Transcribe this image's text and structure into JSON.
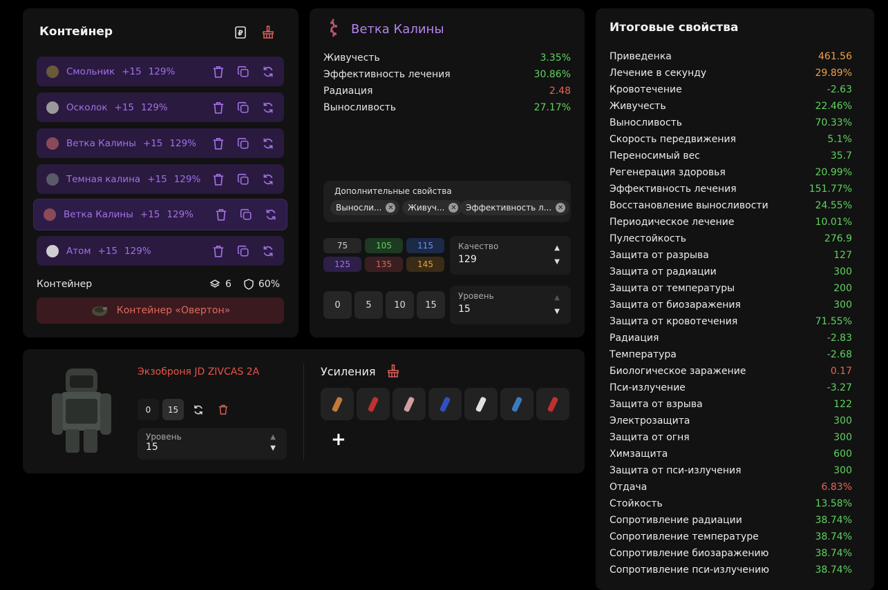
{
  "container": {
    "title": "Контейнер",
    "artifacts": [
      {
        "name": "Смольник",
        "level": "+15",
        "percent": "129%",
        "thumb": "#6b5a3a"
      },
      {
        "name": "Осколок",
        "level": "+15",
        "percent": "129%",
        "thumb": "#9a9a9a"
      },
      {
        "name": "Ветка Калины",
        "level": "+15",
        "percent": "129%",
        "thumb": "#8a4a5a"
      },
      {
        "name": "Темная калина",
        "level": "+15",
        "percent": "129%",
        "thumb": "#5a5a6a"
      },
      {
        "name": "Ветка Калины",
        "level": "+15",
        "percent": "129%",
        "thumb": "#8a4a5a"
      },
      {
        "name": "Атом",
        "level": "+15",
        "percent": "129%",
        "thumb": "#cfcfcf"
      }
    ],
    "summary_label": "Контейнер",
    "slots": "6",
    "protection": "60%",
    "button_label": "Контейнер «Овертон»"
  },
  "artifact": {
    "name": "Ветка Калины",
    "stats": [
      {
        "name": "Живучесть",
        "value": "3.35%",
        "color": "green"
      },
      {
        "name": "Эффективность лечения",
        "value": "30.86%",
        "color": "green"
      },
      {
        "name": "Радиация",
        "value": "2.48",
        "color": "red"
      },
      {
        "name": "Выносливость",
        "value": "27.17%",
        "color": "green"
      }
    ],
    "extra_label": "Дополнительные свойства",
    "extra_chips": [
      "Выносли...",
      "Живуч...",
      "Эффективность л..."
    ],
    "quality_buttons": [
      {
        "label": "75",
        "bg": "#262626",
        "fg": "#cfcfcf"
      },
      {
        "label": "105",
        "bg": "#1e3a22",
        "fg": "#5fd35f"
      },
      {
        "label": "115",
        "bg": "#1c2a48",
        "fg": "#6a8ff0"
      },
      {
        "label": "125",
        "bg": "#2d1f48",
        "fg": "#a271e6"
      },
      {
        "label": "135",
        "bg": "#3a1f22",
        "fg": "#d86a5e"
      },
      {
        "label": "145",
        "bg": "#3a2c16",
        "fg": "#e8a040"
      }
    ],
    "quality_label": "Качество",
    "quality_value": "129",
    "level_buttons": [
      "0",
      "5",
      "10",
      "15"
    ],
    "level_label": "Уровень",
    "level_value": "15"
  },
  "armor": {
    "name": "Экзоброня JD ZIVCAS 2A",
    "level_buttons": [
      "0",
      "15"
    ],
    "level_label": "Уровень",
    "level_value": "15",
    "boosts_title": "Усиления",
    "boost_items": [
      "#c2793a",
      "#c03030",
      "#d0a0a0",
      "#3050c0",
      "#e0e0e0",
      "#3a7ac0",
      "#c03030"
    ],
    "add_label": "+"
  },
  "summary": {
    "title": "Итоговые свойства",
    "rows": [
      {
        "name": "Приведенка",
        "value": "461.56",
        "color": "orange"
      },
      {
        "name": "Лечение в секунду",
        "value": "29.89%",
        "color": "orange"
      },
      {
        "name": "Кровотечение",
        "value": "-2.63",
        "color": "green"
      },
      {
        "name": "Живучесть",
        "value": "22.46%",
        "color": "green"
      },
      {
        "name": "Выносливость",
        "value": "70.33%",
        "color": "green"
      },
      {
        "name": "Скорость передвижения",
        "value": "5.1%",
        "color": "green"
      },
      {
        "name": "Переносимый вес",
        "value": "35.7",
        "color": "green"
      },
      {
        "name": "Регенерация здоровья",
        "value": "20.99%",
        "color": "green"
      },
      {
        "name": "Эффективность лечения",
        "value": "151.77%",
        "color": "green"
      },
      {
        "name": "Восстановление выносливости",
        "value": "24.55%",
        "color": "green"
      },
      {
        "name": "Периодическое лечение",
        "value": "10.01%",
        "color": "green"
      },
      {
        "name": "Пулестойкость",
        "value": "276.9",
        "color": "green"
      },
      {
        "name": "Защита от разрыва",
        "value": "127",
        "color": "green"
      },
      {
        "name": "Защита от радиации",
        "value": "300",
        "color": "green"
      },
      {
        "name": "Защита от температуры",
        "value": "200",
        "color": "green"
      },
      {
        "name": "Защита от биозаражения",
        "value": "300",
        "color": "green"
      },
      {
        "name": "Защита от кровотечения",
        "value": "71.55%",
        "color": "green"
      },
      {
        "name": "Радиация",
        "value": "-2.83",
        "color": "green"
      },
      {
        "name": "Температура",
        "value": "-2.68",
        "color": "green"
      },
      {
        "name": "Биологическое заражение",
        "value": "0.17",
        "color": "red"
      },
      {
        "name": "Пси-излучение",
        "value": "-3.27",
        "color": "green"
      },
      {
        "name": "Защита от взрыва",
        "value": "122",
        "color": "green"
      },
      {
        "name": "Электрозащита",
        "value": "300",
        "color": "green"
      },
      {
        "name": "Защита от огня",
        "value": "300",
        "color": "green"
      },
      {
        "name": "Химзащита",
        "value": "600",
        "color": "green"
      },
      {
        "name": "Защита от пси-излучения",
        "value": "300",
        "color": "green"
      },
      {
        "name": "Отдача",
        "value": "6.83%",
        "color": "red"
      },
      {
        "name": "Стойкость",
        "value": "13.58%",
        "color": "green"
      },
      {
        "name": "Сопротивление радиации",
        "value": "38.74%",
        "color": "green"
      },
      {
        "name": "Сопротивление температуре",
        "value": "38.74%",
        "color": "green"
      },
      {
        "name": "Сопротивление биозаражению",
        "value": "38.74%",
        "color": "green"
      },
      {
        "name": "Сопротивление пси-излучению",
        "value": "38.74%",
        "color": "green"
      }
    ]
  },
  "colors": {
    "accent": "#a271e6",
    "danger": "#e8544a",
    "positive": "#5fd35f",
    "warning": "#f0a04a"
  }
}
